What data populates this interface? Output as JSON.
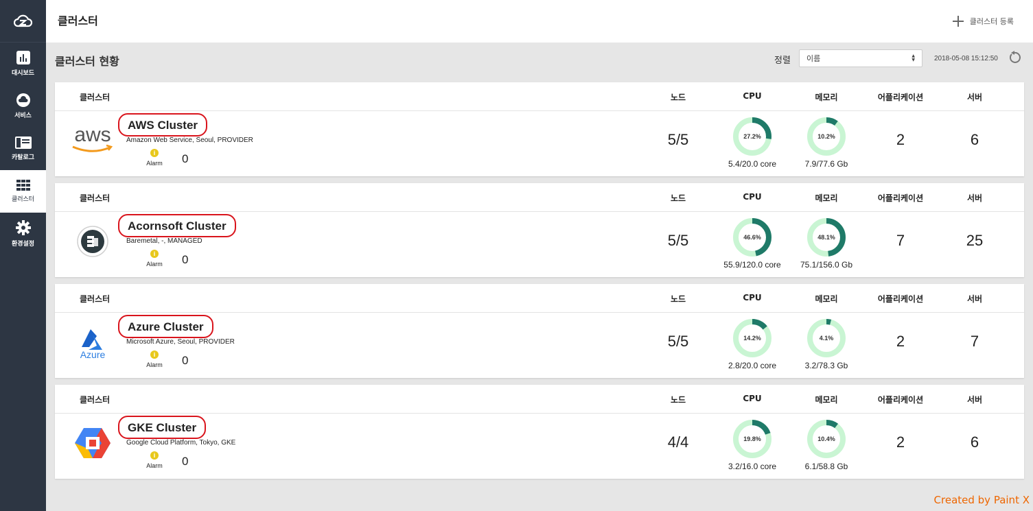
{
  "header": {
    "title": "클러스터",
    "register_label": "클러스터 등록"
  },
  "sidebar": {
    "items": [
      {
        "label": "대시보드",
        "icon": "bar-chart-icon"
      },
      {
        "label": "서비스",
        "icon": "cloud-icon"
      },
      {
        "label": "카탈로그",
        "icon": "book-icon"
      },
      {
        "label": "클러스터",
        "icon": "grid-icon",
        "active": true
      },
      {
        "label": "환경설정",
        "icon": "gear-icon"
      }
    ]
  },
  "toolbar": {
    "title": "클러스터 현황",
    "sort_label": "정렬",
    "sort_value": "이름",
    "timestamp": "2018-05-08 15:12:50"
  },
  "columns": {
    "cluster": "클러스터",
    "node": "노드",
    "cpu": "CPU",
    "memory": "메모리",
    "app": "어플리케이션",
    "server": "서버"
  },
  "clusters": [
    {
      "name": "AWS Cluster",
      "logo": "aws-logo",
      "desc": "Amazon Web Service, Seoul, PROVIDER",
      "alarm_label": "Alarm",
      "alarm_count": "0",
      "nodes": "5/5",
      "cpu_pct": "27.2%",
      "cpu_fraction": 0.272,
      "cpu_sub": "5.4/20.0 core",
      "mem_pct": "10.2%",
      "mem_fraction": 0.102,
      "mem_sub": "7.9/77.6 Gb",
      "apps": "2",
      "servers": "6"
    },
    {
      "name": "Acornsoft Cluster",
      "logo": "baremetal-logo",
      "desc": "Baremetal, -, MANAGED",
      "alarm_label": "Alarm",
      "alarm_count": "0",
      "nodes": "5/5",
      "cpu_pct": "46.6%",
      "cpu_fraction": 0.466,
      "cpu_sub": "55.9/120.0 core",
      "mem_pct": "48.1%",
      "mem_fraction": 0.481,
      "mem_sub": "75.1/156.0 Gb",
      "apps": "7",
      "servers": "25"
    },
    {
      "name": "Azure Cluster",
      "logo": "azure-logo",
      "desc": "Microsoft Azure, Seoul, PROVIDER",
      "alarm_label": "Alarm",
      "alarm_count": "0",
      "nodes": "5/5",
      "cpu_pct": "14.2%",
      "cpu_fraction": 0.142,
      "cpu_sub": "2.8/20.0 core",
      "mem_pct": "4.1%",
      "mem_fraction": 0.041,
      "mem_sub": "3.2/78.3 Gb",
      "apps": "2",
      "servers": "7"
    },
    {
      "name": "GKE Cluster",
      "logo": "gke-logo",
      "desc": "Google Cloud Platform, Tokyo, GKE",
      "alarm_label": "Alarm",
      "alarm_count": "0",
      "nodes": "4/4",
      "cpu_pct": "19.8%",
      "cpu_fraction": 0.198,
      "cpu_sub": "3.2/16.0 core",
      "mem_pct": "10.4%",
      "mem_fraction": 0.104,
      "mem_sub": "6.1/58.8 Gb",
      "apps": "2",
      "servers": "6"
    }
  ],
  "colors": {
    "donut_fill": "#1f7a68",
    "donut_track": "#c9f5d3",
    "sidebar": "#2d3643",
    "highlight": "#d9141c"
  },
  "watermark": "Created by Paint X"
}
